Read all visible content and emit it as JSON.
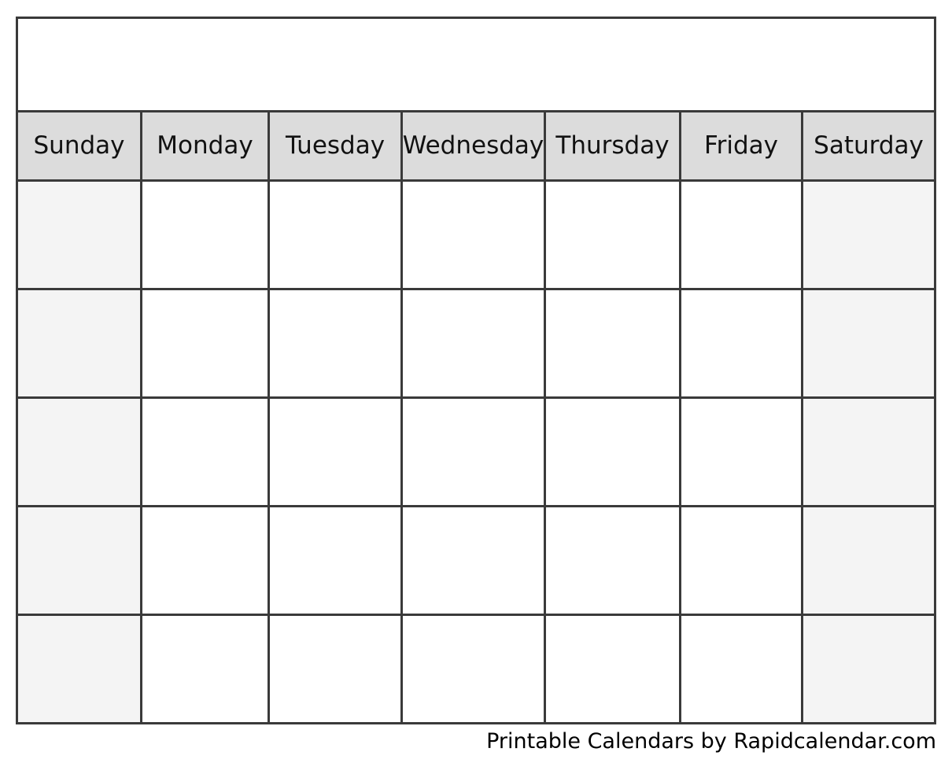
{
  "document": {
    "type": "blank-printable-monthly-calendar",
    "title": "",
    "page_background": "#ffffff"
  },
  "colors": {
    "border": "#3a3a3a",
    "weekday_header_background": "#dcdcdc",
    "weekend_cell_background": "#f4f4f4",
    "weekday_cell_background": "#ffffff",
    "text": "#111111",
    "footer_text": "#000000"
  },
  "calendar": {
    "title_row": {
      "label": "",
      "background": "#ffffff"
    },
    "weekday_headers": [
      {
        "label": "Sunday",
        "weekend": true
      },
      {
        "label": "Monday",
        "weekend": false
      },
      {
        "label": "Tuesday",
        "weekend": false
      },
      {
        "label": "Wednesday",
        "weekend": false
      },
      {
        "label": "Thursday",
        "weekend": false
      },
      {
        "label": "Friday",
        "weekend": false
      },
      {
        "label": "Saturday",
        "weekend": true
      }
    ],
    "weeks": [
      {
        "days": [
          {
            "number": ""
          },
          {
            "number": ""
          },
          {
            "number": ""
          },
          {
            "number": ""
          },
          {
            "number": ""
          },
          {
            "number": ""
          },
          {
            "number": ""
          }
        ]
      },
      {
        "days": [
          {
            "number": ""
          },
          {
            "number": ""
          },
          {
            "number": ""
          },
          {
            "number": ""
          },
          {
            "number": ""
          },
          {
            "number": ""
          },
          {
            "number": ""
          }
        ]
      },
      {
        "days": [
          {
            "number": ""
          },
          {
            "number": ""
          },
          {
            "number": ""
          },
          {
            "number": ""
          },
          {
            "number": ""
          },
          {
            "number": ""
          },
          {
            "number": ""
          }
        ]
      },
      {
        "days": [
          {
            "number": ""
          },
          {
            "number": ""
          },
          {
            "number": ""
          },
          {
            "number": ""
          },
          {
            "number": ""
          },
          {
            "number": ""
          },
          {
            "number": ""
          }
        ]
      },
      {
        "days": [
          {
            "number": ""
          },
          {
            "number": ""
          },
          {
            "number": ""
          },
          {
            "number": ""
          },
          {
            "number": ""
          },
          {
            "number": ""
          },
          {
            "number": ""
          }
        ]
      }
    ]
  },
  "footer": {
    "credit": "Printable Calendars by Rapidcalendar.com"
  }
}
